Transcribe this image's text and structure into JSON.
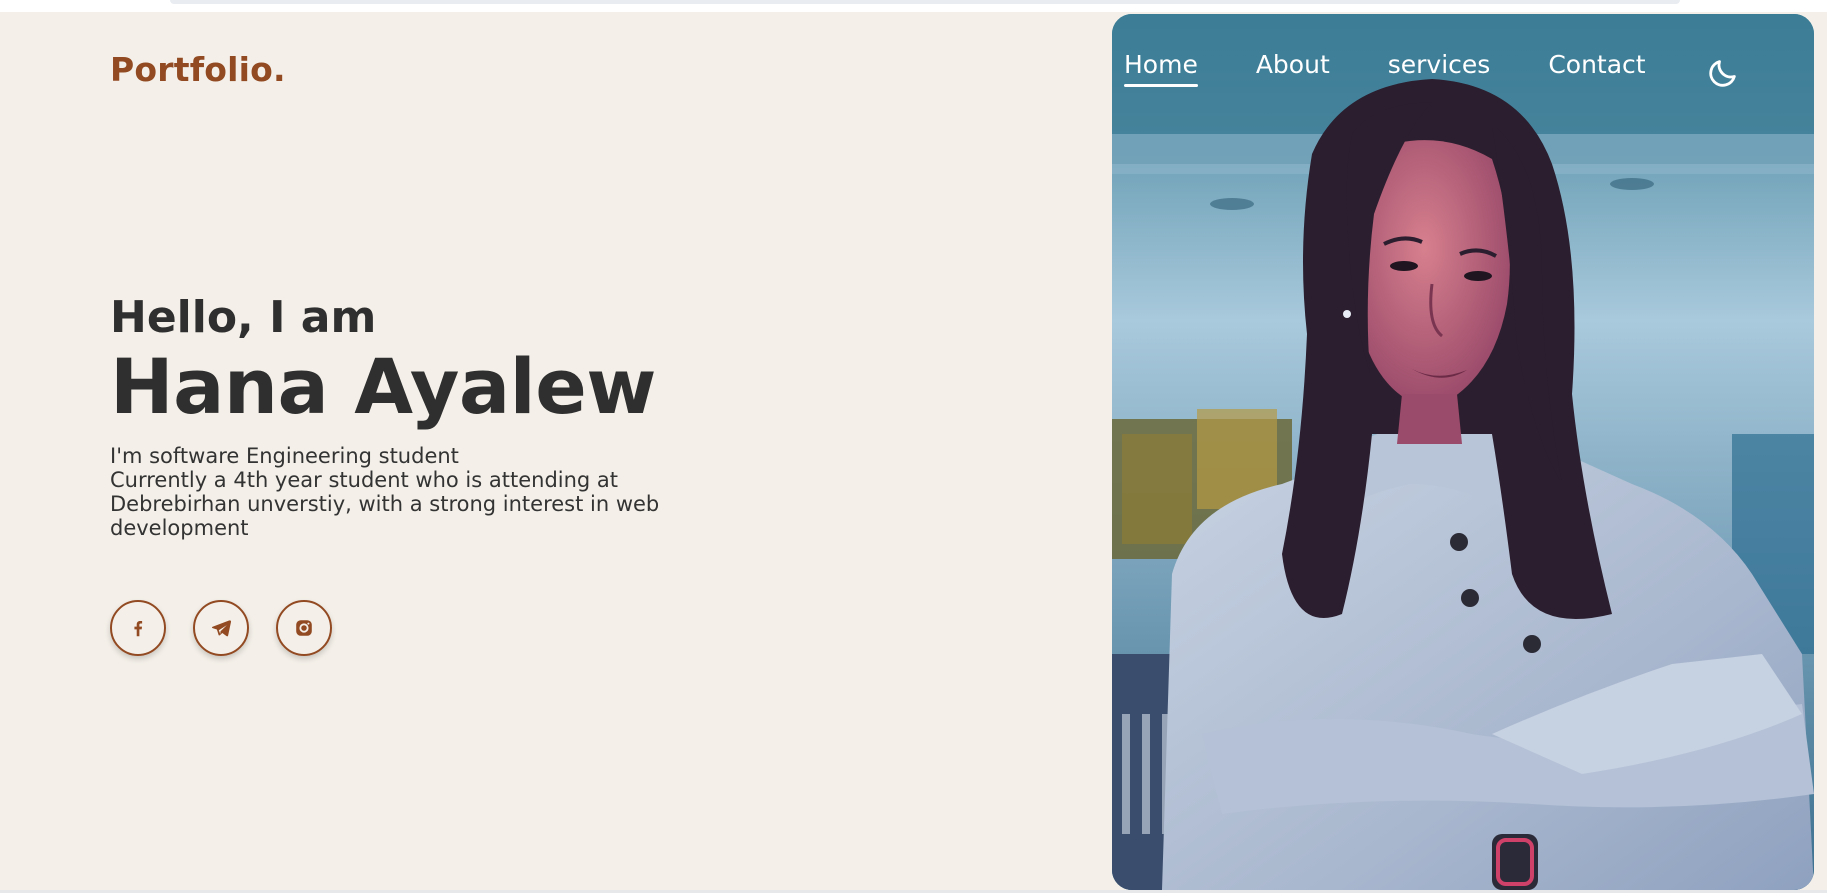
{
  "brand": {
    "logo": "Portfolio."
  },
  "nav": {
    "items": [
      {
        "label": "Home",
        "active": true
      },
      {
        "label": "About",
        "active": false
      },
      {
        "label": "services",
        "active": false
      },
      {
        "label": "Contact",
        "active": false
      }
    ],
    "theme_toggle_icon": "moon-icon"
  },
  "hero": {
    "greeting": "Hello, I am",
    "name": "Hana Ayalew",
    "bio_line_1": "I'm software Engineering student",
    "bio_line_2": "Currently a 4th year student who is attending at Debrebirhan unverstiy, with a strong interest in web development"
  },
  "socials": [
    {
      "icon": "facebook-icon"
    },
    {
      "icon": "telegram-icon"
    },
    {
      "icon": "instagram-icon"
    }
  ],
  "colors": {
    "accent": "#924a22",
    "background": "#f4f0e9",
    "text": "#2f2f2f",
    "nav_text": "#ffffff"
  }
}
